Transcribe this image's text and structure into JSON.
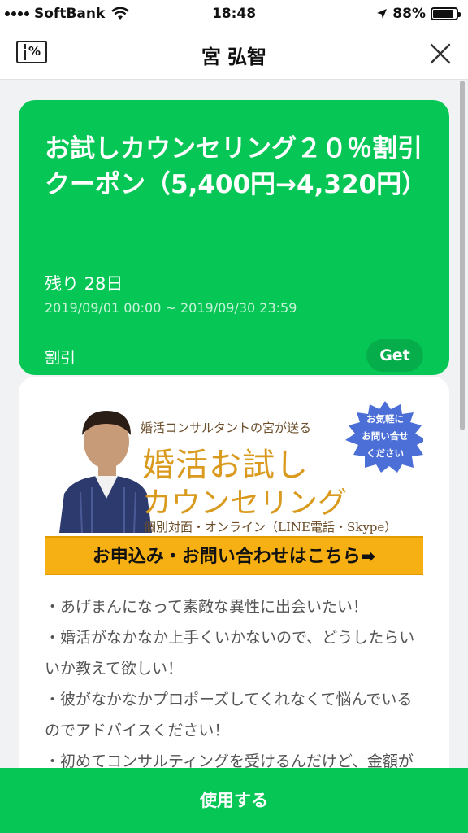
{
  "status_bar": {
    "carrier": "SoftBank",
    "time": "18:48",
    "battery": "88%",
    "battery_level": 0.88
  },
  "header": {
    "title": "宮 弘智",
    "coupon_icon_text": "%"
  },
  "coupon": {
    "title": "お試しカウンセリング２０％割引クーポン（5,400円→4,320円）",
    "remaining": "残り 28日",
    "period": "2019/09/01 00:00 ~ 2019/09/30 23:59",
    "type": "割引",
    "get_label": "Get",
    "card_color": "#06c755"
  },
  "banner": {
    "subtitle": "婚活コンサルタントの宮が送る",
    "main_line1": "婚活お試し",
    "main_line2": "カウンセリング",
    "info": "個別対面・オンライン（LINE電話・Skype）",
    "badge_line1": "お気軽に",
    "badge_line2": "お問い合せ",
    "badge_line3": "ください",
    "cta": "お申込み・お問い合わせはこちら➡"
  },
  "description": [
    "・あげまんになって素敵な異性に出会いたい！",
    "・婚活がなかなか上手くいかないので、どうしたらいいか教えて欲しい！",
    "・彼がなかなかプロポーズしてくれなくて悩んでいるのでアドバイスください！",
    "・初めてコンサルティングを受けるんだけど、金額が高すぎるかも"
  ],
  "use_button": {
    "label": "使用する"
  }
}
